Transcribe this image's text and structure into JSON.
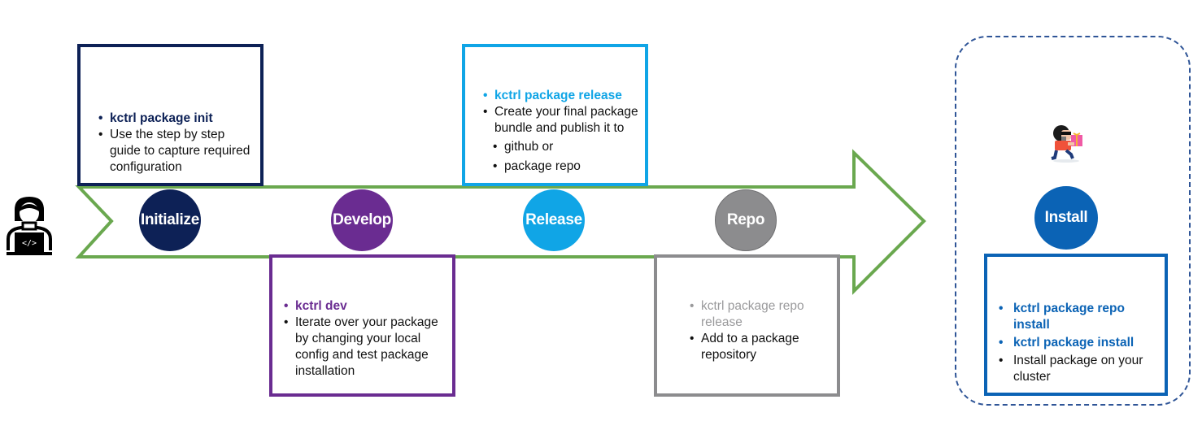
{
  "colors": {
    "arrow": "#6aa84f",
    "initialize": "#0d2156",
    "develop": "#6a2c91",
    "release": "#10a5e6",
    "repo": "#8c8c8e",
    "install": "#0b63b5"
  },
  "icons": {
    "developer": "developer-laptop-icon",
    "delivery": "person-carrying-gift-icon"
  },
  "stages": {
    "initialize": {
      "label": "Initialize",
      "command": "kctrl package init",
      "description": "Use the step by step guide to capture required configuration"
    },
    "develop": {
      "label": "Develop",
      "command": "kctrl dev",
      "description": "Iterate over your package by changing your local config and test package installation"
    },
    "release": {
      "label": "Release",
      "command": "kctrl package release",
      "description": "Create your final package bundle and publish it to",
      "targets": [
        "github or",
        "package repo"
      ]
    },
    "repo": {
      "label": "Repo",
      "command": "kctrl package repo release",
      "description": "Add to a package repository"
    },
    "install": {
      "label": "Install",
      "commands": [
        "kctrl package repo install",
        "kctrl package install"
      ],
      "description": "Install package on your cluster"
    }
  }
}
